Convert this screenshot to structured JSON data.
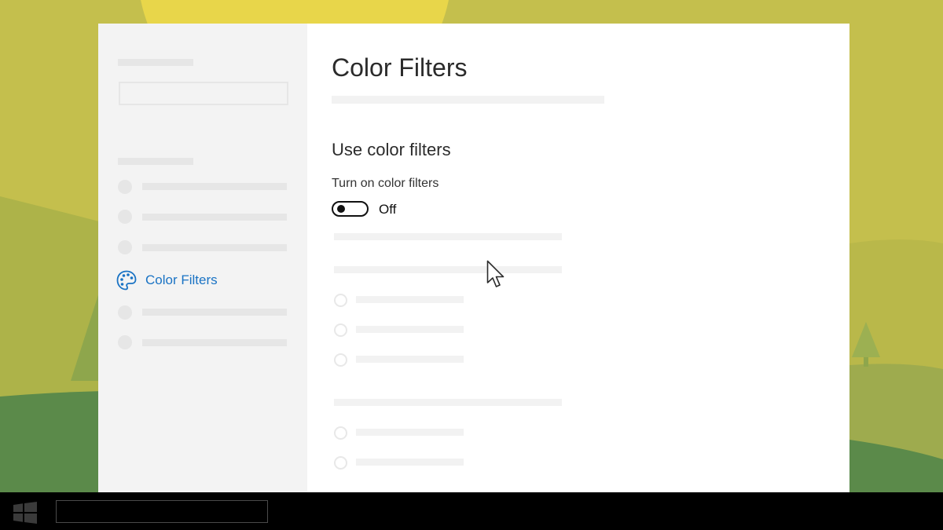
{
  "window": {
    "page_title": "Color Filters",
    "section_title": "Use color filters",
    "toggle": {
      "label": "Turn on color filters",
      "state_text": "Off",
      "checked": false
    }
  },
  "sidebar": {
    "active_item": {
      "label": "Color Filters",
      "icon": "palette-icon"
    }
  },
  "colors": {
    "accent": "#1a73c4",
    "background": "#c4bf4d",
    "sun": "#e8d64a",
    "hill_dark": "#5b8a4a",
    "hill_mid": "#8ea64c",
    "taskbar": "#000000"
  },
  "taskbar": {
    "start_icon": "windows-logo-icon"
  }
}
